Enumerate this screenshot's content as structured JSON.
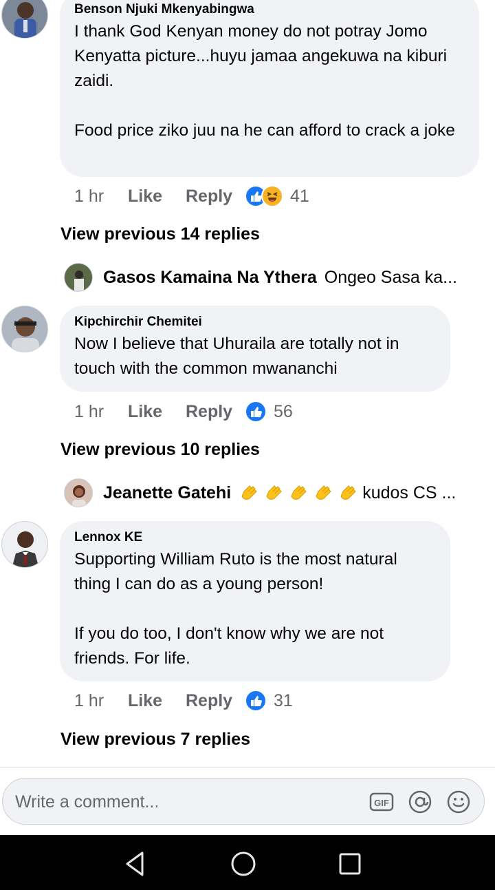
{
  "comments": [
    {
      "author": "Benson Njuki Mkenyabingwa",
      "text": "I thank God Kenyan money do not potray Jomo Kenyatta picture...huyu jamaa angekuwa na kiburi zaidi.\n\nFood price ziko juu na he can afford to crack a joke",
      "time": "1 hr",
      "like_label": "Like",
      "reply_label": "Reply",
      "reaction_count": "41",
      "reactions": [
        "like-icon",
        "haha-icon"
      ],
      "view_replies": "View previous 14 replies",
      "preview": {
        "name": "Gasos Kamaina Na Ythera",
        "text": "Ongeo Sasa ka..."
      }
    },
    {
      "author": "Kipchirchir Chemitei",
      "text": "Now I believe that Uhuraila are totally not in touch with the common mwananchi",
      "time": "1 hr",
      "like_label": "Like",
      "reply_label": "Reply",
      "reaction_count": "56",
      "reactions": [
        "like-icon"
      ],
      "view_replies": "View previous 10 replies",
      "preview": {
        "name": "Jeanette Gatehi",
        "text": "kudos CS ...",
        "emoji": "clapping-hands-emoji x5"
      }
    },
    {
      "author": "Lennox KE",
      "text": "Supporting William Ruto is the most natural thing I can do as a young person!\n\nIf you do too, I don't know why we are not friends. For life.",
      "time": "1 hr",
      "like_label": "Like",
      "reply_label": "Reply",
      "reaction_count": "31",
      "reactions": [
        "like-icon"
      ],
      "view_replies": "View previous 7 replies"
    }
  ],
  "composer": {
    "placeholder": "Write a comment...",
    "icons": [
      "gif-icon",
      "at-mention-icon",
      "emoji-icon"
    ]
  },
  "navbar": {
    "icons": [
      "back-icon",
      "home-icon",
      "recents-icon"
    ]
  },
  "colors": {
    "bubble": "#f0f2f5",
    "like_blue": "#1877f2",
    "muted": "#65676b",
    "haha_yellow": "#f7b125"
  }
}
